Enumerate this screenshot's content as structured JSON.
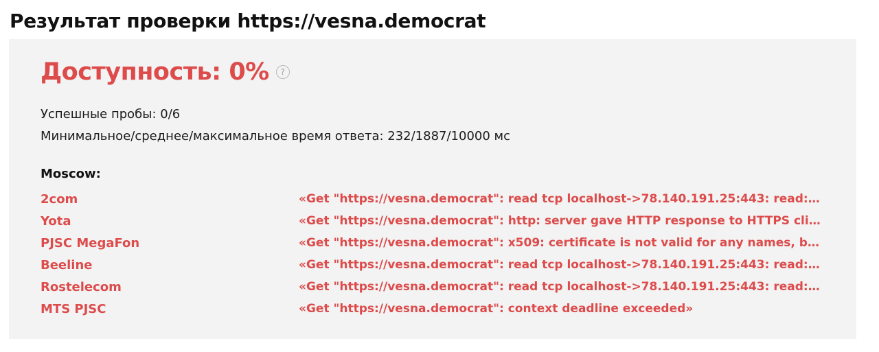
{
  "page": {
    "title": "Результат проверки https://vesna.democrat"
  },
  "result": {
    "availability": "Доступность: 0%",
    "help_icon": "?",
    "probes_line": "Успешные пробы: 0/6",
    "response_time_line": "Минимальное/среднее/максимальное время ответа: 232/1887/10000 мс",
    "region": "Moscow:",
    "probes": [
      {
        "provider": "2com",
        "error": "«Get \"https://vesna.democrat\": read tcp localhost->78.140.191.25:443: read: con..."
      },
      {
        "provider": "Yota",
        "error": "«Get \"https://vesna.democrat\": http: server gave HTTP response to HTTPS clie..."
      },
      {
        "provider": "PJSC MegaFon",
        "error": "«Get \"https://vesna.democrat\": x509: certificate is not valid for any names, but..."
      },
      {
        "provider": "Beeline",
        "error": "«Get \"https://vesna.democrat\": read tcp localhost->78.140.191.25:443: read: con..."
      },
      {
        "provider": "Rostelecom",
        "error": "«Get \"https://vesna.democrat\": read tcp localhost->78.140.191.25:443: read: con..."
      },
      {
        "provider": "MTS PJSC",
        "error": "«Get \"https://vesna.democrat\": context deadline exceeded»"
      }
    ]
  },
  "colors": {
    "accent_red": "#dd4b4b",
    "panel_bg": "#f3f3f3",
    "text_dark": "#111111"
  }
}
